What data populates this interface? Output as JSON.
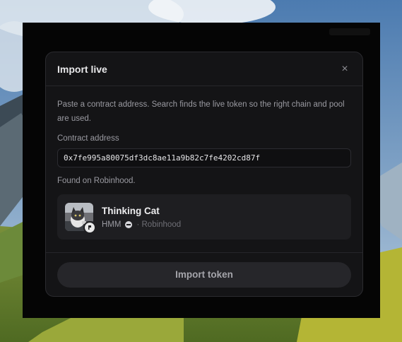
{
  "dialog": {
    "title": "Import live",
    "close_label": "×",
    "description": "Paste a contract address. Search finds the live token so the right chain and pool are used.",
    "address_label": "Contract address",
    "address_value": "0x7fe995a80075df3dc8ae11a9b82c7fe4202cd87f",
    "found_text": "Found on Robinhood.",
    "import_button_label": "Import token"
  },
  "token": {
    "name": "Thinking Cat",
    "symbol": "HMM",
    "chain": "· Robinhood",
    "chain_icon": "robinhood-chain-icon",
    "avatar_icon": "cat-avatar"
  }
}
